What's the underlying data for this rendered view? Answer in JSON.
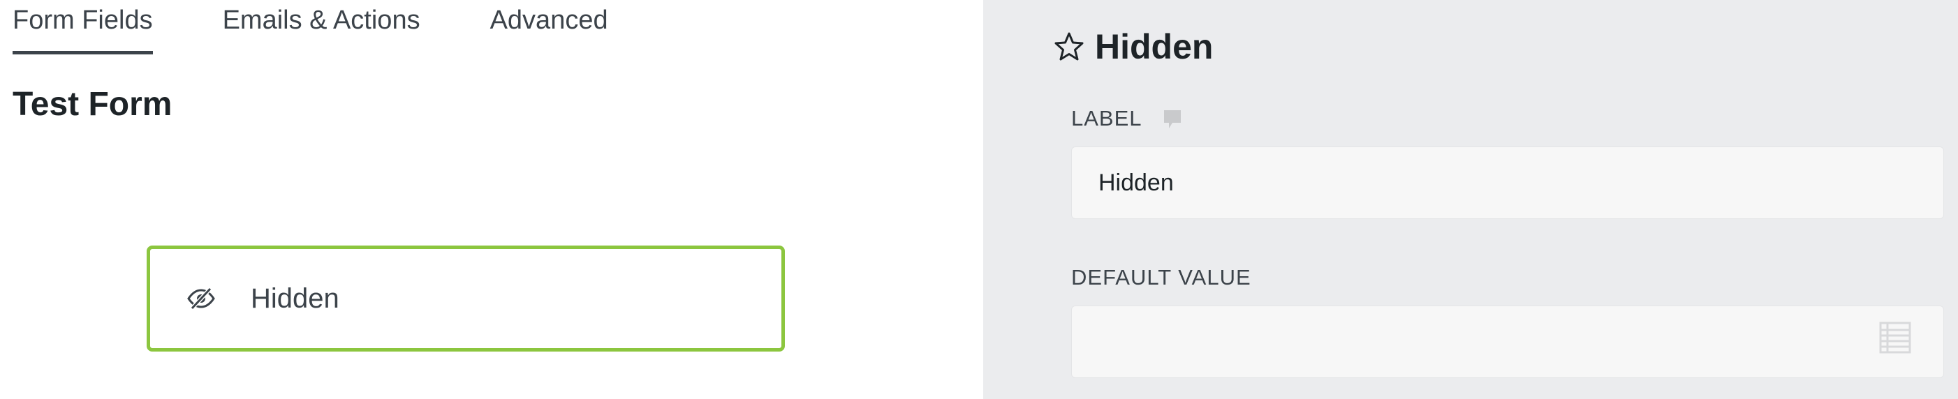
{
  "tabs": [
    {
      "label": "Form Fields",
      "active": true
    },
    {
      "label": "Emails & Actions",
      "active": false
    },
    {
      "label": "Advanced",
      "active": false
    }
  ],
  "form": {
    "title": "Test Form",
    "field": {
      "label": "Hidden",
      "icon": "eye-slash-icon"
    }
  },
  "settings": {
    "title": "Hidden",
    "title_icon": "star-icon",
    "label_field": {
      "label": "LABEL",
      "hint_icon": "comment-icon",
      "value": "Hidden"
    },
    "default_value_field": {
      "label": "DEFAULT VALUE",
      "value": "",
      "merge_icon": "merge-tags-icon"
    }
  },
  "colors": {
    "active_field_border": "#8cc63f",
    "panel_background": "#ebecee"
  }
}
